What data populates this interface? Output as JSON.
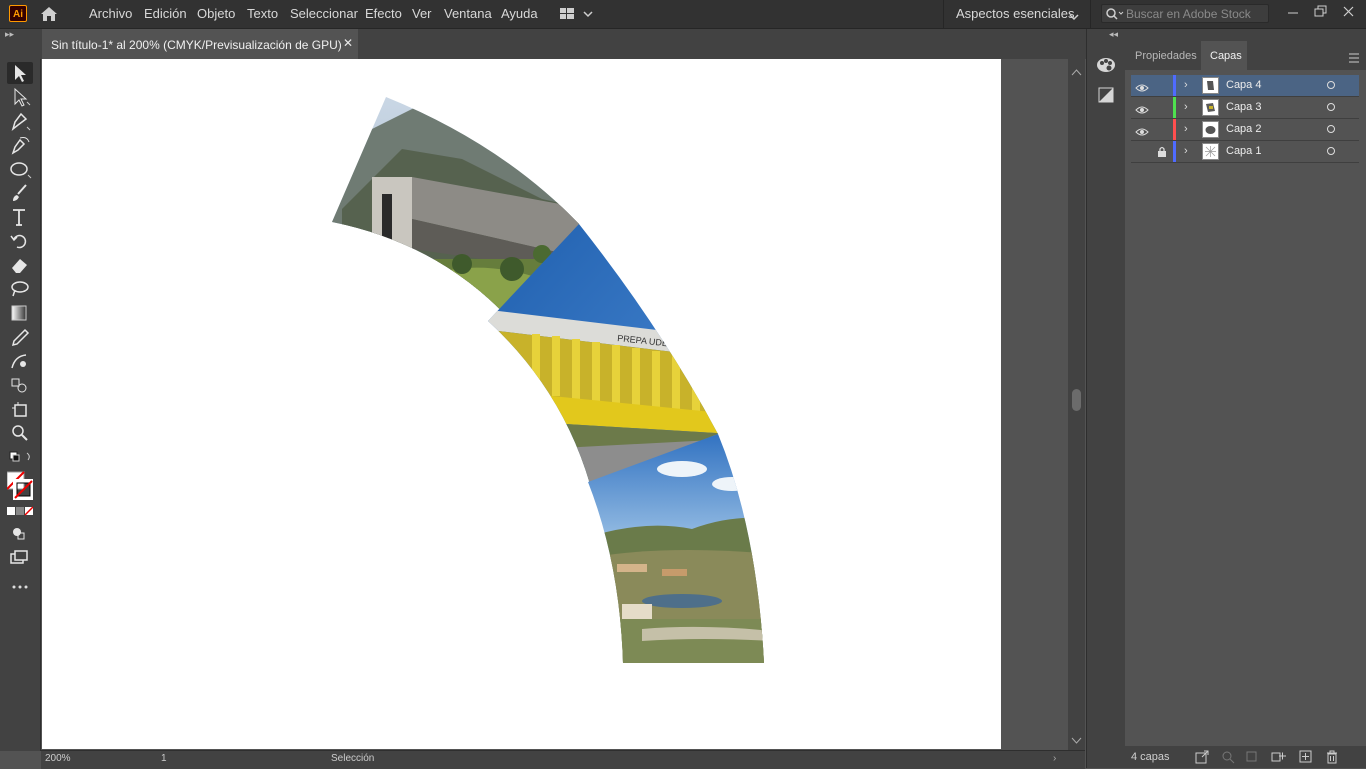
{
  "app": {
    "logo_text": "Ai",
    "menu": [
      "Archivo",
      "Edición",
      "Objeto",
      "Texto",
      "Seleccionar",
      "Efecto",
      "Ver",
      "Ventana",
      "Ayuda"
    ],
    "workspace": "Aspectos esenciales",
    "search_placeholder": "Buscar en Adobe Stock"
  },
  "document": {
    "tab_title": "Sin título-1* al 200% (CMYK/Previsualización de GPU)",
    "close_glyph": "✕"
  },
  "tools": [
    "selection-tool-icon",
    "direct-selection-tool-icon",
    "pen-tool-icon",
    "curvature-tool-icon",
    "ellipse-tool-icon",
    "paintbrush-tool-icon",
    "type-tool-icon",
    "rotate-tool-icon",
    "eraser-tool-icon",
    "lasso-tool-icon",
    "gradient-tool-icon",
    "eyedropper-tool-icon",
    "blend-tool-icon",
    "shape-builder-tool-icon",
    "artboard-tool-icon",
    "zoom-tool-icon"
  ],
  "status": {
    "zoom": "200%",
    "artboard_index": "1",
    "mode_text": "Selección"
  },
  "panel": {
    "tabs": [
      "Propiedades",
      "Capas"
    ],
    "active_tab": "Capas",
    "layers": [
      {
        "name": "Capa 4",
        "color": "#4f6bff",
        "visible": true,
        "locked": false,
        "selected": true
      },
      {
        "name": "Capa 3",
        "color": "#4fe04f",
        "visible": true,
        "locked": false,
        "selected": false
      },
      {
        "name": "Capa 2",
        "color": "#ff4f4f",
        "visible": true,
        "locked": false,
        "selected": false
      },
      {
        "name": "Capa 1",
        "color": "#4f6bff",
        "visible": false,
        "locked": true,
        "selected": false
      }
    ],
    "layer_count": "4 capas"
  },
  "colors": {
    "chrome_dark": "#323232",
    "chrome_mid": "#424242",
    "canvas": "#535353",
    "selection": "#4b6484"
  }
}
